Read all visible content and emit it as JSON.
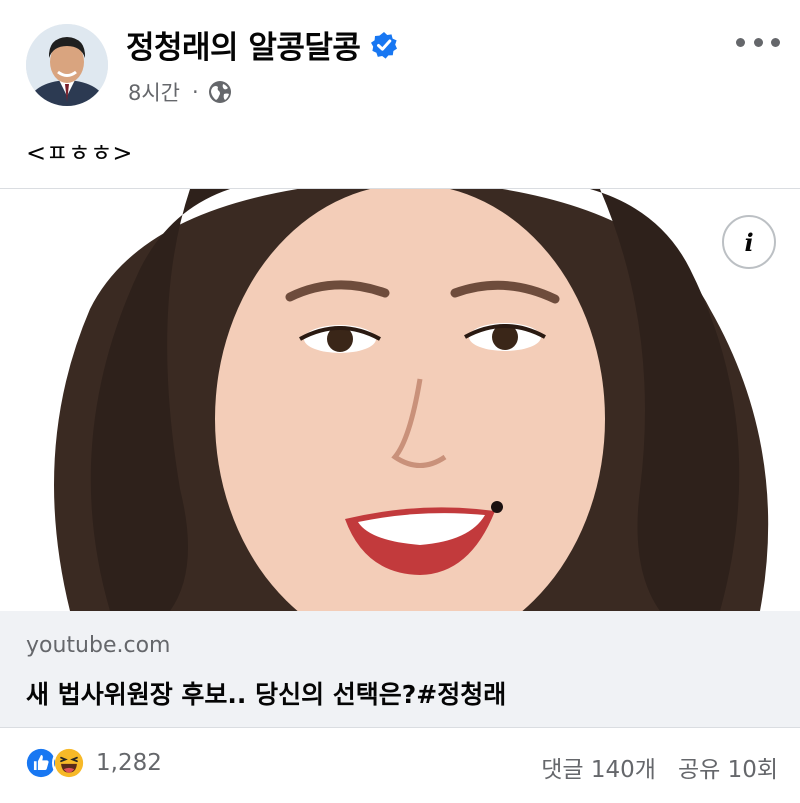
{
  "post": {
    "author": "정청래의 알콩달콩",
    "timestamp": "8시간",
    "separator": "·",
    "text": "<ㅍㅎㅎ>"
  },
  "link_preview": {
    "domain": "youtube.com",
    "title": "새 법사위원장 후보.. 당신의 선택은?#정청래",
    "info_label": "i"
  },
  "engagement": {
    "reaction_count": "1,282",
    "comments": "댓글 140개",
    "shares": "공유 10회"
  },
  "icons": {
    "verified": "verified-badge-icon",
    "audience": "globe-icon",
    "more": "more-horizontal-icon",
    "like": "like-reaction-icon",
    "haha": "haha-reaction-icon",
    "info": "info-icon"
  },
  "colors": {
    "facebook_blue": "#1877f2",
    "secondary_text": "#65676b",
    "link_background": "#f0f2f5",
    "haha_yellow": "#f7b928"
  }
}
